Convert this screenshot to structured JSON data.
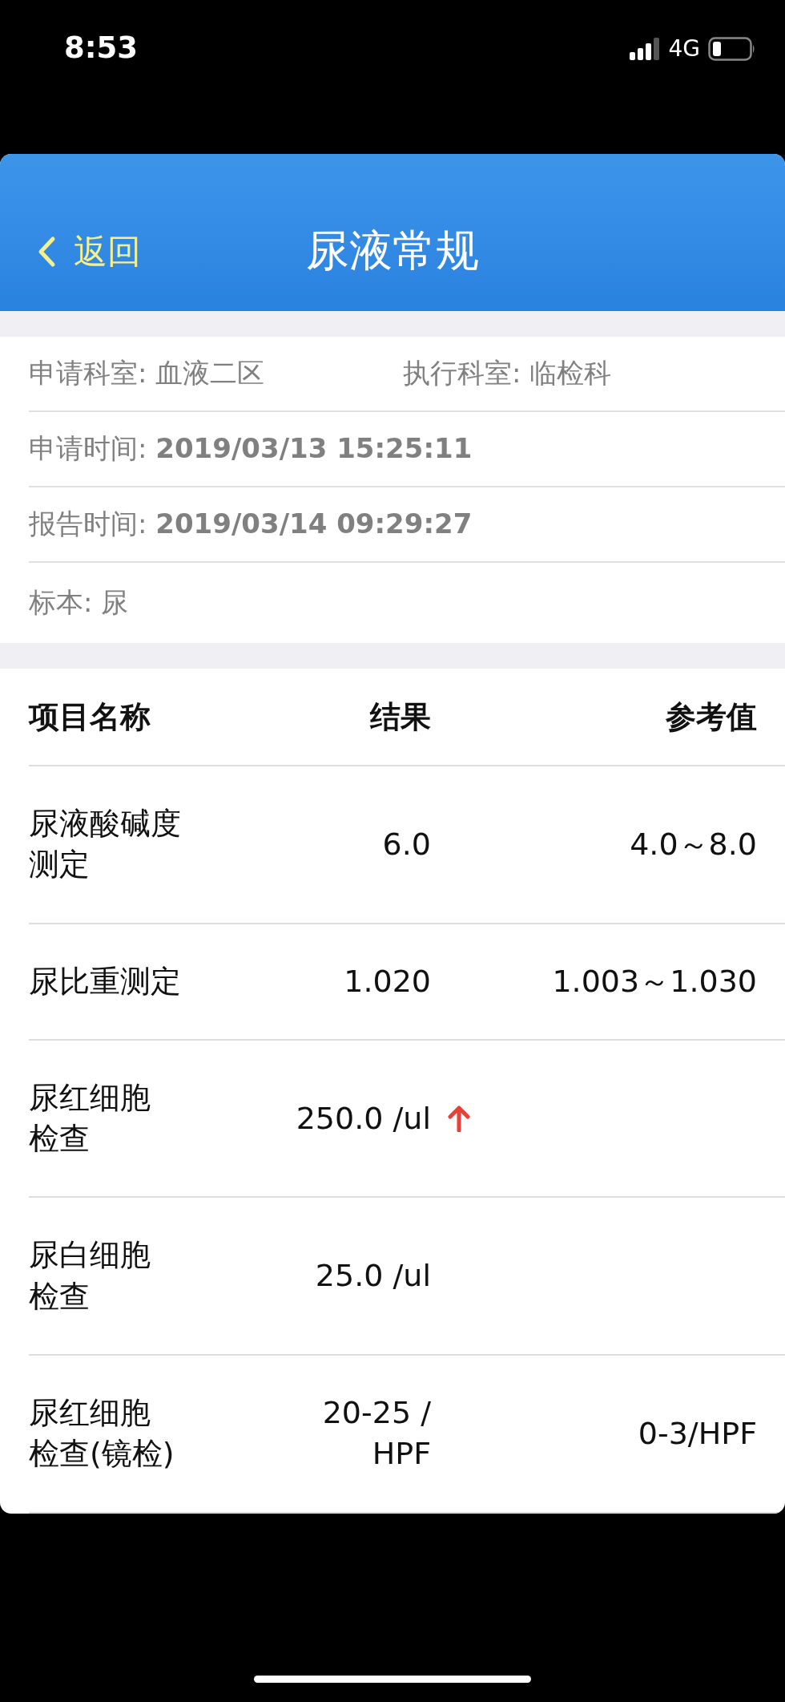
{
  "status_bar": {
    "time": "8:53",
    "network": "4G"
  },
  "header": {
    "back": "返回",
    "title": "尿液常规"
  },
  "info": {
    "row_1": [
      "申请科室: 血液二区",
      "执行科室: 临检科"
    ],
    "rows": [
      "申请时间: **2019/03/13 15:25:11**",
      "报告时间: **2019/03/14 09:29:27**",
      "标本: 尿"
    ]
  },
  "table": {
    "columns": [
      "项目名称",
      "结果",
      "参考值"
    ],
    "rows": [
      {
        "name": [
          "尿液酸碱度",
          "测定"
        ],
        "result": [
          "6.0"
        ],
        "high": false,
        "reference": "4.0～8.0"
      },
      {
        "name": [
          "尿比重测定"
        ],
        "result": [
          "1.020"
        ],
        "high": false,
        "reference": "1.003～1.030"
      },
      {
        "name": [
          "尿红细胞",
          "检查"
        ],
        "result": [
          "250.0 /ul"
        ],
        "high": true
      },
      {
        "name": [
          "尿白细胞",
          "检查"
        ],
        "result": [
          "25.0 /ul"
        ],
        "high": false
      },
      {
        "name": [
          "尿红细胞",
          "检查(镜检)"
        ],
        "result": [
          "20-25 /",
          "HPF"
        ],
        "high": false,
        "reference": "0-3/HPF"
      }
    ]
  }
}
